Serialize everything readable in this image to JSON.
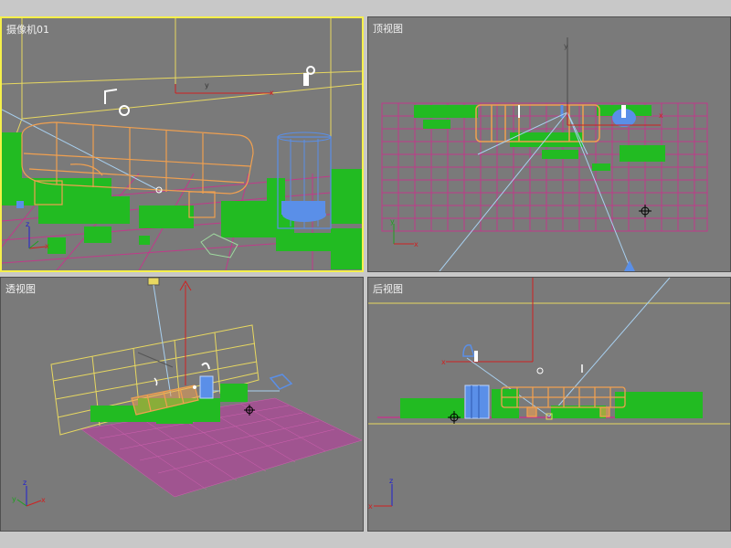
{
  "viewports": {
    "camera": {
      "label": "摄像机01"
    },
    "top": {
      "label": "顶视图"
    },
    "perspective": {
      "label": "透视图"
    },
    "back": {
      "label": "后视图"
    }
  },
  "axes": {
    "x": "x",
    "y": "y",
    "z": "z"
  },
  "colors": {
    "viewport_bg": "#7a7a7a",
    "active_border": "#f5f04a",
    "grass": "#22bb22",
    "bench_wire": "#f0a050",
    "trash_bin": "#5a8fe8",
    "ground_grid": "#c03a8a",
    "camera_frustum": "#e8d860",
    "camera_ray": "#a8d0f0",
    "axis_x": "#d02020",
    "axis_y": "#20a020",
    "axis_z": "#2020d0"
  }
}
